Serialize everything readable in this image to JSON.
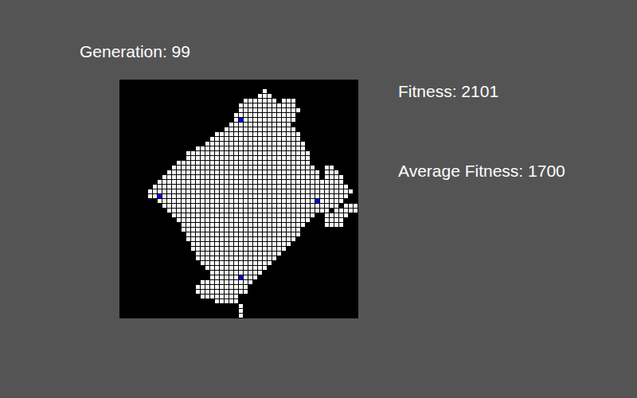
{
  "generation": "Generation: 99",
  "stats": [
    {
      "label": "Fitness: 2101"
    },
    {
      "label": "Average Fitness: 1700"
    }
  ],
  "grid": {
    "rows": [
      [],
      [],
      [
        [
          30,
          30
        ]
      ],
      [
        [
          29,
          31
        ]
      ],
      [
        [
          26,
          32
        ],
        [
          34,
          36
        ]
      ],
      [
        [
          25,
          36
        ]
      ],
      [
        [
          25,
          37
        ]
      ],
      [
        [
          24,
          36
        ]
      ],
      [
        [
          24,
          36
        ]
      ],
      [
        [
          23,
          35
        ]
      ],
      [
        [
          22,
          36
        ]
      ],
      [
        [
          20,
          37
        ]
      ],
      [
        [
          19,
          37
        ]
      ],
      [
        [
          18,
          38
        ]
      ],
      [
        [
          16,
          38
        ]
      ],
      [
        [
          14,
          39
        ]
      ],
      [
        [
          14,
          39
        ]
      ],
      [
        [
          12,
          39
        ]
      ],
      [
        [
          11,
          40
        ],
        [
          43,
          44
        ]
      ],
      [
        [
          10,
          41
        ],
        [
          43,
          45
        ]
      ],
      [
        [
          9,
          41
        ],
        [
          43,
          46
        ]
      ],
      [
        [
          8,
          46
        ]
      ],
      [
        [
          7,
          47
        ]
      ],
      [
        [
          6,
          48
        ]
      ],
      [
        [
          6,
          47
        ]
      ],
      [
        [
          8,
          46
        ]
      ],
      [
        [
          9,
          45
        ],
        [
          47,
          49
        ]
      ],
      [
        [
          10,
          43
        ],
        [
          45,
          49
        ]
      ],
      [
        [
          11,
          40
        ],
        [
          43,
          47
        ]
      ],
      [
        [
          12,
          39
        ],
        [
          43,
          46
        ]
      ],
      [
        [
          13,
          38
        ],
        [
          43,
          46
        ]
      ],
      [
        [
          13,
          37
        ]
      ],
      [
        [
          14,
          37
        ]
      ],
      [
        [
          14,
          36
        ]
      ],
      [
        [
          15,
          35
        ]
      ],
      [
        [
          15,
          34
        ]
      ],
      [
        [
          16,
          33
        ]
      ],
      [
        [
          16,
          32
        ]
      ],
      [
        [
          17,
          31
        ]
      ],
      [
        [
          18,
          30
        ]
      ],
      [
        [
          19,
          29
        ]
      ],
      [
        [
          19,
          28
        ]
      ],
      [
        [
          17,
          27
        ]
      ],
      [
        [
          16,
          26
        ]
      ],
      [
        [
          16,
          26
        ]
      ],
      [
        [
          17,
          24
        ]
      ],
      [
        [
          20,
          24
        ]
      ],
      [
        [
          25,
          25
        ]
      ],
      [
        [
          25,
          25
        ]
      ],
      [
        [
          25,
          25
        ]
      ]
    ],
    "highlights": [
      {
        "row": 8,
        "col": 25
      },
      {
        "row": 24,
        "col": 8
      },
      {
        "row": 25,
        "col": 41
      },
      {
        "row": 41,
        "col": 25
      }
    ]
  }
}
